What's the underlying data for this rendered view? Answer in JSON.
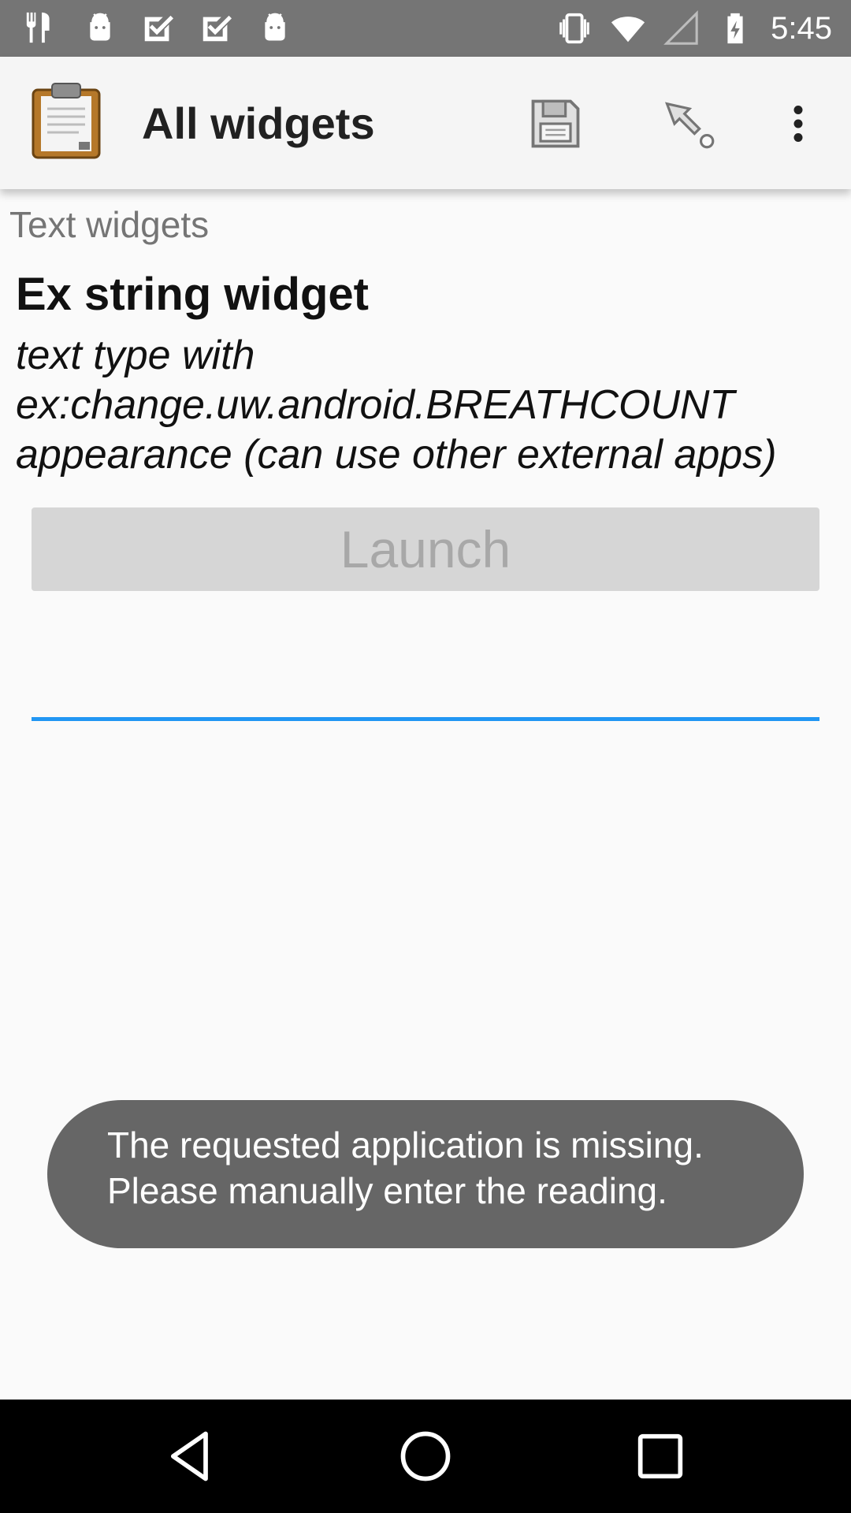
{
  "status_bar": {
    "time": "5:45",
    "left_icons": [
      "fork-knife-icon",
      "android-icon",
      "check-box-icon",
      "check-box-icon",
      "android-icon"
    ],
    "right_icons": [
      "vibrate-icon",
      "wifi-icon",
      "signal-icon",
      "battery-charging-icon"
    ]
  },
  "app_bar": {
    "title": "All widgets",
    "icons": [
      "clipboard-icon",
      "save-icon",
      "goto-icon",
      "more-vert-icon"
    ]
  },
  "content": {
    "group_label": "Text widgets",
    "question_title": "Ex string widget",
    "question_hint": "text type with ex:change.uw.android.BREATHCOUNT appearance (can use other external apps)",
    "launch_label": "Launch",
    "answer_value": ""
  },
  "toast": {
    "line1": "The requested application is missing.",
    "line2": "Please manually enter the reading."
  },
  "colors": {
    "status_bar": "#757575",
    "app_bar": "#f5f5f5",
    "accent": "#2196f3",
    "button_disabled": "#d6d6d6",
    "toast": "#666666",
    "nav_bar": "#000000"
  }
}
